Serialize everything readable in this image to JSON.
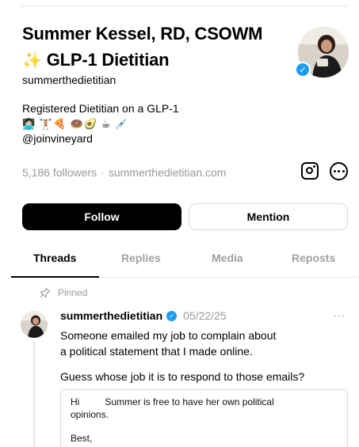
{
  "profile": {
    "name_line1": "Summer Kessel, RD, CSOWM",
    "name_line2": "GLP-1 Dietitian",
    "sparkle_icon": "sparkles-icon",
    "username": "summerthedietitian",
    "bio_line1": "Registered Dietitian on a GLP-1",
    "bio_emojis": "👩🏻‍💻 🏋🏻🍕 🍩🥑 ☕ 💉",
    "bio_mention": "@joinvineyard",
    "followers": "5,186 followers",
    "separator": "·",
    "website": "summerthedietitian.com",
    "verified_check": "✓"
  },
  "actions": {
    "follow_label": "Follow",
    "mention_label": "Mention"
  },
  "tabs": {
    "threads": "Threads",
    "replies": "Replies",
    "media": "Media",
    "reposts": "Reposts"
  },
  "post": {
    "pinned_label": "Pinned",
    "author": "summerthedietitian",
    "date": "05/22/25",
    "more": "···",
    "line1": "Someone emailed my job to complain about",
    "line2": "a political statement that I made online.",
    "line3": "Guess whose job it is to respond to those emails?",
    "quote_greeting": "Hi",
    "quote_line1": "Summer is free to have her own political",
    "quote_line2": "opinions.",
    "quote_signoff": "Best,"
  },
  "colors": {
    "verified": "#1d9bf0",
    "muted_text": "#999999",
    "follow_bg": "#000000"
  }
}
